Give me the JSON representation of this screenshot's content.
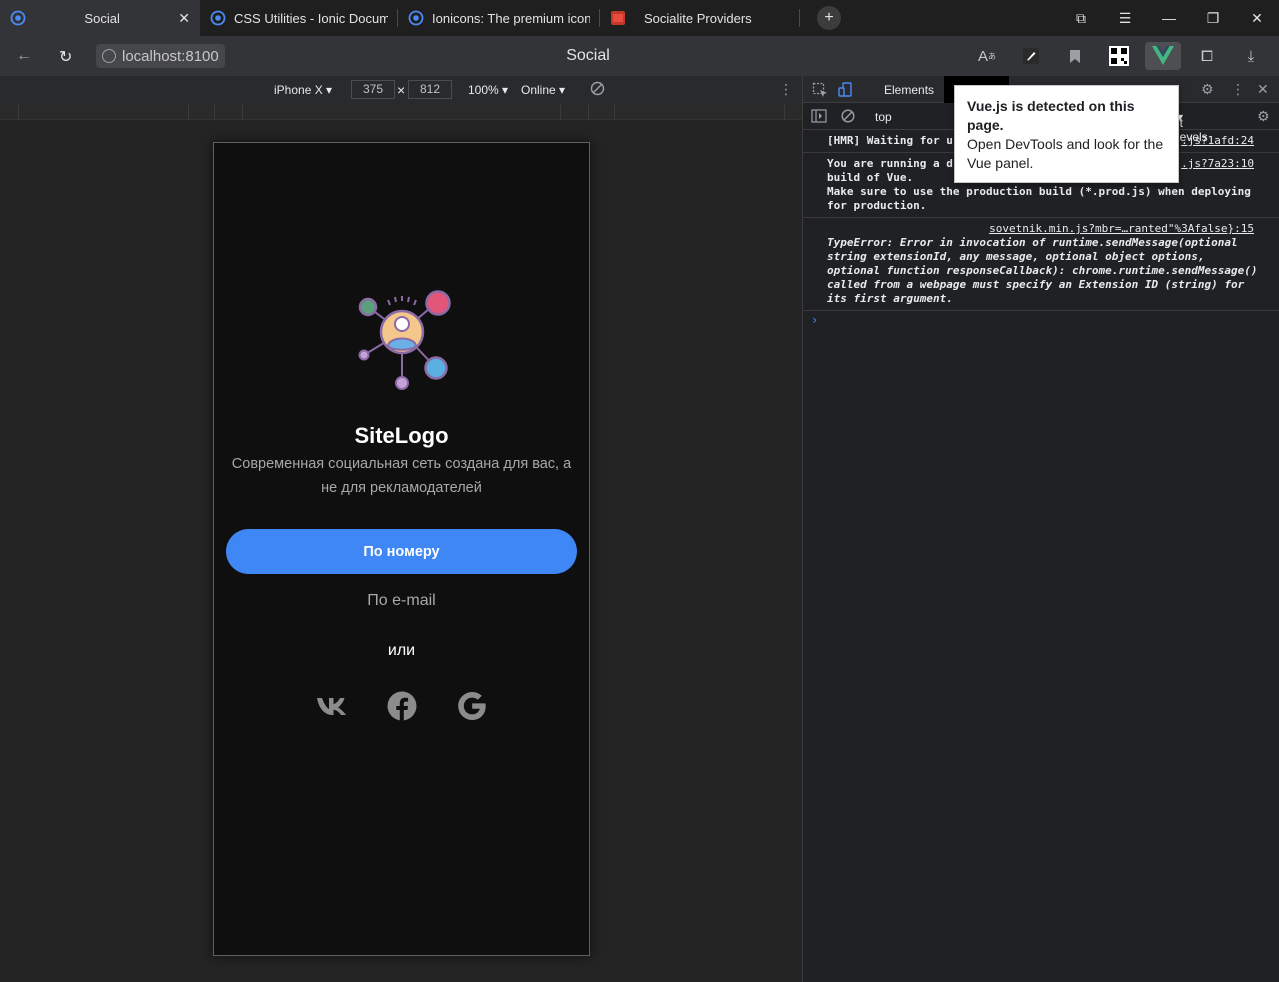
{
  "tabs": [
    {
      "title": "Social",
      "active": true,
      "favicon": "ionic-icon"
    },
    {
      "title": "CSS Utilities - Ionic Documentation",
      "favicon": "ionic-icon"
    },
    {
      "title": "Ionicons: The premium icon pack",
      "favicon": "ionic-icon"
    },
    {
      "title": "Socialite Providers",
      "favicon": "sp-icon"
    }
  ],
  "newtab": "+",
  "address": {
    "url": "localhost:8100",
    "page_title": "Social"
  },
  "devicebar": {
    "device": "iPhone X",
    "width": "375",
    "times": "×",
    "height": "812",
    "zoom": "100%",
    "network": "Online"
  },
  "app": {
    "logo_text": "SiteLogo",
    "tagline": "Современная социальная сеть создана для вас, а не для рекламодателей",
    "phone_button": "По номеру",
    "email_link": "По e-mail",
    "or": "или",
    "social": [
      "vk-icon",
      "facebook-icon",
      "google-icon"
    ]
  },
  "devtools": {
    "tab_elements": "Elements",
    "context": "top",
    "levels": "lt levels",
    "console": [
      {
        "text": "[HMR] Waiting for u",
        "source": ".js?1afd:24"
      },
      {
        "text": "You are running a d\nbuild of Vue.\nMake sure to use the production build (*.prod.js) when deploying\nfor production.",
        "source": ".js?7a23:10"
      },
      {
        "source": "sovetnik.min.js?mbr=…ranted\"%3Afalse}:15",
        "text": "TypeError: Error in invocation of runtime.sendMessage(optional\nstring extensionId, any message, optional object options,\noptional function responseCallback): chrome.runtime.sendMessage()\ncalled from a webpage must specify an Extension ID (string) for\nits first argument."
      }
    ],
    "prompt": "›"
  },
  "tooltip": {
    "title": "Vue.js is detected on this page.",
    "body": "Open DevTools and look for the Vue panel."
  },
  "colors": {
    "accent": "#3f87f5",
    "phone_bg": "#0f0f0f",
    "vue_green": "#41b883"
  }
}
